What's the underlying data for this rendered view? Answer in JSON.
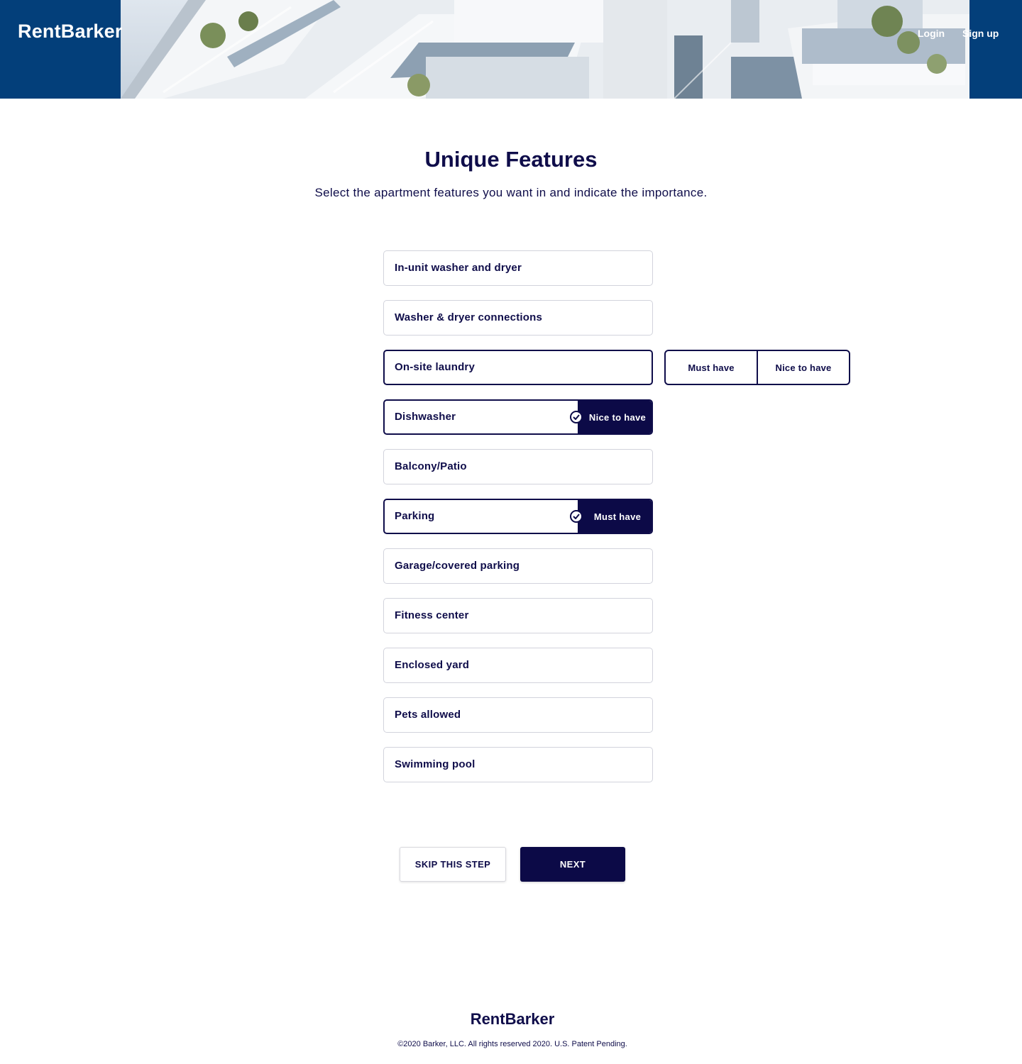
{
  "header": {
    "logo": "RentBarker",
    "nav": {
      "login": "Login",
      "signup": "Sign up"
    }
  },
  "main": {
    "title": "Unique Features",
    "subtitle": "Select the apartment features you want in and indicate the importance.",
    "features": [
      {
        "label": "In-unit washer and dryer",
        "status": ""
      },
      {
        "label": "Washer & dryer connections",
        "status": ""
      },
      {
        "label": "On-site laundry",
        "status": "selecting"
      },
      {
        "label": "Dishwasher",
        "status": "Nice to have"
      },
      {
        "label": "Balcony/Patio",
        "status": ""
      },
      {
        "label": "Parking",
        "status": "Must have"
      },
      {
        "label": "Garage/covered parking",
        "status": ""
      },
      {
        "label": "Fitness center",
        "status": ""
      },
      {
        "label": "Enclosed yard",
        "status": ""
      },
      {
        "label": "Pets allowed",
        "status": ""
      },
      {
        "label": "Swimming pool",
        "status": ""
      }
    ],
    "importance_options": {
      "must": "Must have",
      "nice": "Nice to have"
    },
    "buttons": {
      "skip": "SKIP THIS STEP",
      "next": "NEXT"
    }
  },
  "footer": {
    "logo": "RentBarker",
    "copyright": "©2020 Barker, LLC. All rights reserved 2020. U.S. Patent Pending."
  },
  "colors": {
    "header_bg": "#033f7a",
    "primary": "#0c0a47",
    "border": "#d2d3dc"
  },
  "icons": {
    "check": "check-circle-icon"
  }
}
